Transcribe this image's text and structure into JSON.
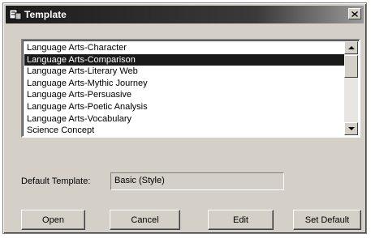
{
  "window": {
    "title": "Template",
    "close_symbol": "×"
  },
  "list": {
    "items": [
      "Language Arts-Character",
      "Language Arts-Comparison",
      "Language Arts-Literary Web",
      "Language Arts-Mythic Journey",
      "Language Arts-Persuasive",
      "Language Arts-Poetic Analysis",
      "Language Arts-Vocabulary",
      "Science Concept"
    ],
    "selected_index": 1
  },
  "default_template": {
    "label": "Default Template:",
    "value": "Basic (Style)"
  },
  "buttons": {
    "open": "Open",
    "cancel": "Cancel",
    "edit": "Edit",
    "set_default": "Set Default"
  },
  "colors": {
    "title_bar": "#1c1c1c",
    "dialog_face": "#d4d0c8",
    "selection": "#1a1a1a"
  },
  "icons": {
    "title": "template-app-icon",
    "close": "close-icon"
  }
}
